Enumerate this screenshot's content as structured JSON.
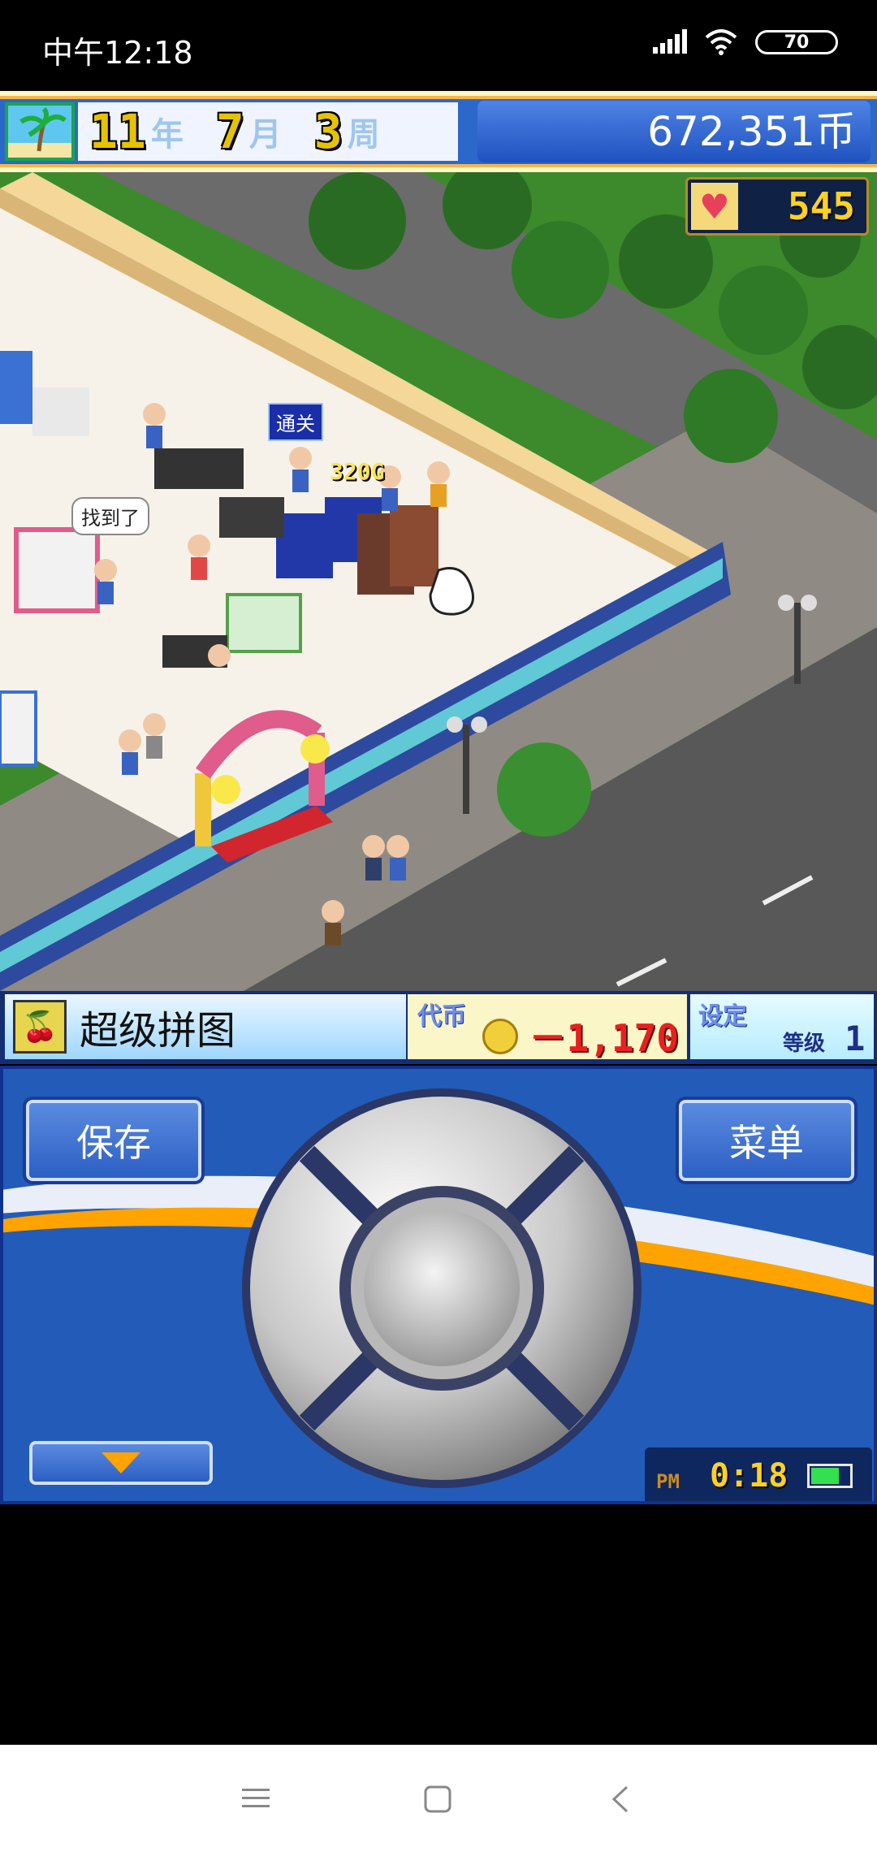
{
  "status_bar": {
    "time": "中午12:18",
    "battery": "70"
  },
  "top_bar": {
    "year_num": "11",
    "year_unit": "年",
    "month_num": "7",
    "month_unit": "月",
    "week_num": "3",
    "week_unit": "周",
    "money": "672,351币"
  },
  "hearts": "545",
  "scene": {
    "speech_bubble": "找到了",
    "tag_label": "通关",
    "floating_gold": "320G"
  },
  "info_bar": {
    "game_name": "超级拼图",
    "coin_label": "代币",
    "coin_value": "－1,170",
    "settings_label": "设定",
    "level_label": "等级",
    "level_value": "1"
  },
  "controls": {
    "save": "保存",
    "menu": "菜单",
    "ampm": "PM",
    "time": "0:18"
  },
  "colors": {
    "panel_blue": "#235bb8",
    "accent_orange": "#ffa300",
    "grass_green": "#3c8a2c"
  }
}
